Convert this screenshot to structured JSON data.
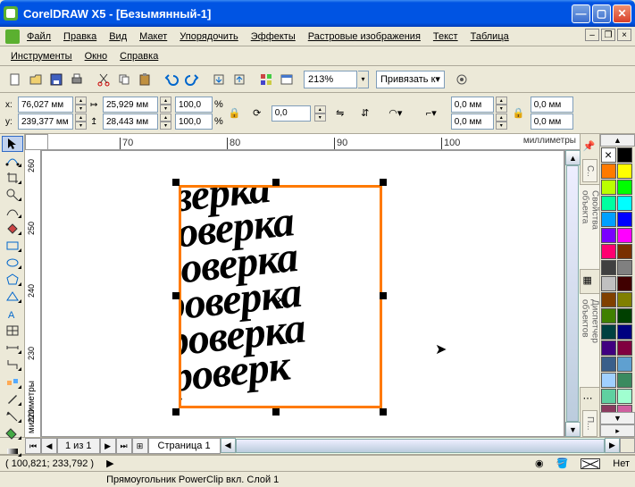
{
  "title": "CorelDRAW X5 - [Безымянный-1]",
  "menu": {
    "file": "Файл",
    "edit": "Правка",
    "view": "Вид",
    "layout": "Макет",
    "arrange": "Упорядочить",
    "effects": "Эффекты",
    "bitmaps": "Растровые изображения",
    "text": "Текст",
    "table": "Таблица",
    "tools": "Инструменты",
    "window": "Окно",
    "help": "Справка"
  },
  "toolbar": {
    "zoom": "213%",
    "snap": "Привязать к"
  },
  "propbar": {
    "x_label": "x:",
    "y_label": "y:",
    "x": "76,027 мм",
    "y": "239,377 мм",
    "w": "25,929 мм",
    "h": "28,443 мм",
    "sx": "100,0",
    "sy": "100,0",
    "pct": "%",
    "rot": "0,0",
    "dim1": "0,0 мм",
    "dim2": "0,0 мм",
    "d_extra": "0,0 мм"
  },
  "ruler": {
    "h_labels": [
      "70",
      "80",
      "90",
      "100"
    ],
    "v_labels": [
      "260",
      "250",
      "240",
      "230",
      "220"
    ],
    "unit": "миллиметры"
  },
  "page_nav": {
    "label": "1 из 1",
    "tab": "Страница 1"
  },
  "status": {
    "coords": "( 100,821; 233,792 )",
    "object": "Прямоугольник PowerClip вкл. Слой 1",
    "fill_none": "Нет"
  },
  "dockers": {
    "props": "Свойства объекта",
    "mgr": "Диспетчер объектов",
    "hint": "С..",
    "more": "П..."
  },
  "palette_colors": [
    "#000000",
    "#ff7a00",
    "#ffff00",
    "#baff00",
    "#00ff00",
    "#00ffa0",
    "#00ffff",
    "#00a0ff",
    "#0000ff",
    "#7a00ff",
    "#ff00ff",
    "#ff0070",
    "#7a3000",
    "#404040",
    "#808080",
    "#c0c0c0",
    "#400000",
    "#804000",
    "#808000",
    "#408000",
    "#004000",
    "#004040",
    "#000080",
    "#400080",
    "#800040",
    "#3a5f8a",
    "#5fa0d0",
    "#a0d0ff",
    "#3a8a5f",
    "#5fd0a0",
    "#a0ffd0",
    "#8a3a5f",
    "#d05fa0",
    "#ffa0d0",
    "#00ff80",
    "#80ff00",
    "#ff8000",
    "#ff0080",
    "#8000ff",
    "#0080ff"
  ],
  "canvas_text": "оверка\nроверка\nроверка\nроверка\nроверка\nроверк"
}
